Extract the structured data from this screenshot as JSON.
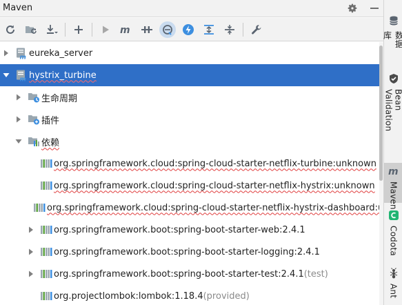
{
  "window": {
    "title": "Maven"
  },
  "title_actions": [
    {
      "name": "settings-gear-icon"
    },
    {
      "name": "hide-minus-icon"
    }
  ],
  "toolbar": [
    {
      "name": "reload-icon",
      "tip": "Reload All Maven Projects"
    },
    {
      "name": "generate-sources-icon",
      "tip": "Generate Sources"
    },
    {
      "name": "download-icon",
      "tip": "Download Sources"
    },
    {
      "name": "add-icon",
      "tip": "Add Maven Projects"
    },
    {
      "name": "run-icon",
      "tip": "Run Maven Build"
    },
    {
      "name": "execute-goal-icon",
      "tip": "Execute Maven Goal"
    },
    {
      "name": "toggle-offline-icon",
      "tip": "Toggle Offline Mode"
    },
    {
      "name": "skip-tests-icon",
      "tip": "Toggle Skip Tests Mode"
    },
    {
      "name": "lightning-icon",
      "tip": "Show Dependencies"
    },
    {
      "name": "collapse-all-icon",
      "tip": "Collapse All"
    },
    {
      "name": "expand-all-icon",
      "tip": "Expand All"
    },
    {
      "name": "wrench-icon",
      "tip": "Maven Settings"
    }
  ],
  "tree": {
    "nodes": [
      {
        "label": "eureka_server",
        "level": 0,
        "arrow": "collapsed",
        "icon": "maven-module-icon",
        "squiggle": false,
        "selected": false
      },
      {
        "label": "hystrix_turbine",
        "level": 0,
        "arrow": "expanded",
        "icon": "maven-module-icon",
        "squiggle": true,
        "selected": true
      },
      {
        "label": "生命周期",
        "level": 1,
        "arrow": "collapsed",
        "icon": "lifecycle-folder-icon",
        "squiggle": false,
        "selected": false
      },
      {
        "label": "插件",
        "level": 1,
        "arrow": "collapsed",
        "icon": "plugins-folder-icon",
        "squiggle": false,
        "selected": false
      },
      {
        "label": "依赖",
        "level": 1,
        "arrow": "expanded",
        "icon": "dependencies-folder-icon",
        "squiggle": true,
        "selected": false
      },
      {
        "label": "org.springframework.cloud:spring-cloud-starter-netflix-turbine:unknown",
        "level": 2,
        "arrow": "none",
        "icon": "library-icon",
        "squiggle": true,
        "selected": false
      },
      {
        "label": "org.springframework.cloud:spring-cloud-starter-netflix-hystrix:unknown",
        "level": 2,
        "arrow": "none",
        "icon": "library-icon",
        "squiggle": true,
        "selected": false
      },
      {
        "label": "org.springframework.cloud:spring-cloud-starter-netflix-hystrix-dashboard:unk",
        "level": 2,
        "arrow": "none",
        "icon": "library-icon",
        "squiggle": true,
        "selected": false
      },
      {
        "label": "org.springframework.boot:spring-boot-starter-web:2.4.1",
        "level": 2,
        "arrow": "collapsed",
        "icon": "library-icon",
        "squiggle": false,
        "selected": false
      },
      {
        "label": "org.springframework.boot:spring-boot-starter-logging:2.4.1",
        "level": 2,
        "arrow": "collapsed",
        "icon": "library-icon",
        "squiggle": false,
        "selected": false
      },
      {
        "label": "org.springframework.boot:spring-boot-starter-test:2.4.1",
        "scope": " (test)",
        "level": 2,
        "arrow": "collapsed",
        "icon": "library-icon",
        "squiggle": false,
        "selected": false
      },
      {
        "label": "org.projectlombok:lombok:1.18.4",
        "scope": " (provided)",
        "level": 2,
        "arrow": "none",
        "icon": "library-icon",
        "squiggle": false,
        "selected": false
      }
    ]
  },
  "right_tabs": [
    {
      "label": "数据库",
      "icon": "database-icon",
      "active": false
    },
    {
      "label": "Bean Validation",
      "icon": "bean-validation-icon",
      "active": false
    },
    {
      "label": "Maven",
      "icon": "maven-icon",
      "active": true
    },
    {
      "label": "Codota",
      "icon": "codota-icon",
      "active": false
    },
    {
      "label": "Ant",
      "icon": "ant-icon",
      "active": false
    }
  ],
  "colors": {
    "selection": "#2f6fc7",
    "squiggle": "#e03c3c",
    "folder": "#9aa7b0",
    "maven_blue": "#3d8fe0",
    "accent_toolbar": "#c9dbef"
  }
}
